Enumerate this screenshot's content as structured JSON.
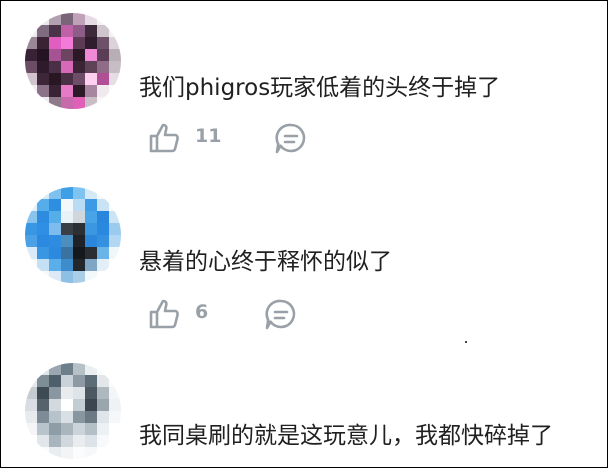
{
  "comments": [
    {
      "text": "我们phigros玩家低着的头终于掉了",
      "likes": "11",
      "avatar_colors": [
        "#f7f7f7",
        "#e8e8e8",
        "#b0a0b0",
        "#7a6478",
        "#bfa2b8",
        "#e6dbe4",
        "#f4f4f4",
        "#fafafa",
        "#ececec",
        "#806c80",
        "#4a3348",
        "#c061a8",
        "#8e5c86",
        "#3d2a3a",
        "#cfc5cd",
        "#f2f2f2",
        "#9a8898",
        "#3b2333",
        "#e05ec0",
        "#f37ad8",
        "#5d3b55",
        "#2f1c2c",
        "#6c5168",
        "#dcd3da",
        "#3a2236",
        "#241423",
        "#a65294",
        "#6d4562",
        "#2b1827",
        "#f08ad8",
        "#5a3e55",
        "#b9aeb6",
        "#6b4e66",
        "#2e1a2b",
        "#4b2f46",
        "#d76ab8",
        "#3a2435",
        "#5e4358",
        "#8f6d88",
        "#c7bdc5",
        "#d0c3cd",
        "#3d2638",
        "#281623",
        "#4a3044",
        "#6f4d68",
        "#ffd0f0",
        "#b04f96",
        "#e4dde2",
        "#f1eef0",
        "#8c7288",
        "#392233",
        "#e57bc7",
        "#2d1a29",
        "#a7849f",
        "#efeaee",
        "#fbfbfb",
        "#fafafa",
        "#eeeaed",
        "#8f7a8b",
        "#c66aab",
        "#e060b8",
        "#c9bec6",
        "#f7f7f7",
        "#fdfdfd"
      ]
    },
    {
      "text": "悬着的心终于释怀的似了",
      "likes": "6",
      "avatar_colors": [
        "#f8fafc",
        "#d8eaf8",
        "#7ec0ee",
        "#3f9fe6",
        "#7fc4f0",
        "#d5e9f7",
        "#f5f9fc",
        "#ffffff",
        "#e4f1fa",
        "#55aeea",
        "#2e8fe0",
        "#f4f8fb",
        "#b9dcf4",
        "#3d9ae4",
        "#c9e3f5",
        "#f8fbfd",
        "#88c4ee",
        "#2d8be0",
        "#56aee9",
        "#e9f2f8",
        "#d0d6dc",
        "#49a3e7",
        "#2a86dc",
        "#cde4f4",
        "#3996e2",
        "#2f8fe2",
        "#7dbced",
        "#3a3f45",
        "#2c2f33",
        "#3b97e1",
        "#2a88df",
        "#9acbef",
        "#4aa1e6",
        "#2b89df",
        "#2f8de1",
        "#4c8fbf",
        "#1f2327",
        "#2b87db",
        "#3590df",
        "#b2d7f2",
        "#d9ebf8",
        "#3896e3",
        "#2d89de",
        "#3a73a0",
        "#16191c",
        "#2a2d31",
        "#6ab4ea",
        "#f0f7fb",
        "#f8fbfd",
        "#c3e0f4",
        "#5aaeea",
        "#3d8ccc",
        "#23272b",
        "#7fa6c4",
        "#e3eff7",
        "#ffffff",
        "#ffffff",
        "#f6fafc",
        "#dbeaf6",
        "#8ebfe4",
        "#aacde8",
        "#f3f8fb",
        "#ffffff",
        "#ffffff"
      ]
    },
    {
      "text": "我同桌刷的就是这玩意儿，我都快碎掉了",
      "avatar_colors": [
        "#fbfbfb",
        "#e0e4e7",
        "#9aa7b0",
        "#6d7f8b",
        "#b5c0c7",
        "#eaeef0",
        "#fafafa",
        "#ffffff",
        "#e6e9ec",
        "#7f8d97",
        "#4f5f6a",
        "#c9d2d8",
        "#8d9aa3",
        "#5d6d78",
        "#e3e7ea",
        "#fcfcfc",
        "#c4ccd2",
        "#3e4b54",
        "#8a97a0",
        "#e8ecef",
        "#dfe4e8",
        "#4c5963",
        "#aeb8bf",
        "#f4f5f6",
        "#d7dde2",
        "#56636c",
        "#d2dae0",
        "#ffffff",
        "#c2ccd3",
        "#3b4650",
        "#9aa6ae",
        "#eff2f4",
        "#e7ebee",
        "#7d8c96",
        "#b7c3cb",
        "#d9e0e5",
        "#8896a0",
        "#6b7a85",
        "#dfe5e9",
        "#f6f7f8",
        "#f3f5f7",
        "#b8c4cc",
        "#8f9da7",
        "#aab6be",
        "#cbd4da",
        "#b3c0c8",
        "#eef1f3",
        "#ffffff",
        "#ffffff",
        "#e1e6ea",
        "#a9b5bd",
        "#d0d8de",
        "#e9edf0",
        "#dde4e9",
        "#f8f9fa",
        "#ffffff",
        "#ffffff",
        "#fafbfb",
        "#e9edf0",
        "#f2f4f6",
        "#fbfcfc",
        "#f7f8f9",
        "#ffffff",
        "#ffffff"
      ]
    }
  ]
}
